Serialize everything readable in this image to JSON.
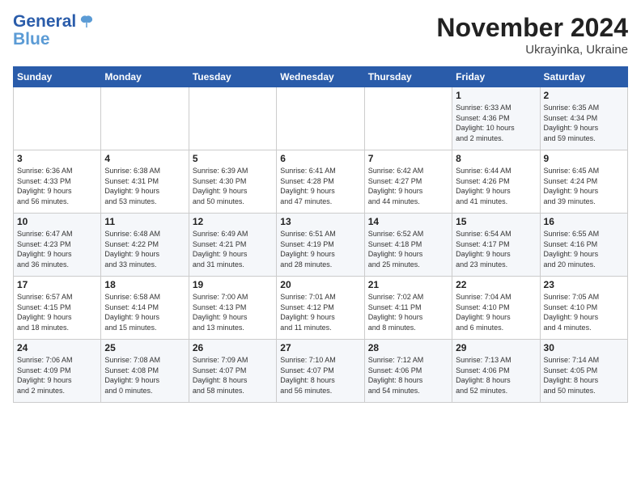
{
  "header": {
    "logo_line1": "General",
    "logo_line2": "Blue",
    "month": "November 2024",
    "location": "Ukrayinka, Ukraine"
  },
  "weekdays": [
    "Sunday",
    "Monday",
    "Tuesday",
    "Wednesday",
    "Thursday",
    "Friday",
    "Saturday"
  ],
  "weeks": [
    [
      {
        "day": "",
        "info": ""
      },
      {
        "day": "",
        "info": ""
      },
      {
        "day": "",
        "info": ""
      },
      {
        "day": "",
        "info": ""
      },
      {
        "day": "",
        "info": ""
      },
      {
        "day": "1",
        "info": "Sunrise: 6:33 AM\nSunset: 4:36 PM\nDaylight: 10 hours\nand 2 minutes."
      },
      {
        "day": "2",
        "info": "Sunrise: 6:35 AM\nSunset: 4:34 PM\nDaylight: 9 hours\nand 59 minutes."
      }
    ],
    [
      {
        "day": "3",
        "info": "Sunrise: 6:36 AM\nSunset: 4:33 PM\nDaylight: 9 hours\nand 56 minutes."
      },
      {
        "day": "4",
        "info": "Sunrise: 6:38 AM\nSunset: 4:31 PM\nDaylight: 9 hours\nand 53 minutes."
      },
      {
        "day": "5",
        "info": "Sunrise: 6:39 AM\nSunset: 4:30 PM\nDaylight: 9 hours\nand 50 minutes."
      },
      {
        "day": "6",
        "info": "Sunrise: 6:41 AM\nSunset: 4:28 PM\nDaylight: 9 hours\nand 47 minutes."
      },
      {
        "day": "7",
        "info": "Sunrise: 6:42 AM\nSunset: 4:27 PM\nDaylight: 9 hours\nand 44 minutes."
      },
      {
        "day": "8",
        "info": "Sunrise: 6:44 AM\nSunset: 4:26 PM\nDaylight: 9 hours\nand 41 minutes."
      },
      {
        "day": "9",
        "info": "Sunrise: 6:45 AM\nSunset: 4:24 PM\nDaylight: 9 hours\nand 39 minutes."
      }
    ],
    [
      {
        "day": "10",
        "info": "Sunrise: 6:47 AM\nSunset: 4:23 PM\nDaylight: 9 hours\nand 36 minutes."
      },
      {
        "day": "11",
        "info": "Sunrise: 6:48 AM\nSunset: 4:22 PM\nDaylight: 9 hours\nand 33 minutes."
      },
      {
        "day": "12",
        "info": "Sunrise: 6:49 AM\nSunset: 4:21 PM\nDaylight: 9 hours\nand 31 minutes."
      },
      {
        "day": "13",
        "info": "Sunrise: 6:51 AM\nSunset: 4:19 PM\nDaylight: 9 hours\nand 28 minutes."
      },
      {
        "day": "14",
        "info": "Sunrise: 6:52 AM\nSunset: 4:18 PM\nDaylight: 9 hours\nand 25 minutes."
      },
      {
        "day": "15",
        "info": "Sunrise: 6:54 AM\nSunset: 4:17 PM\nDaylight: 9 hours\nand 23 minutes."
      },
      {
        "day": "16",
        "info": "Sunrise: 6:55 AM\nSunset: 4:16 PM\nDaylight: 9 hours\nand 20 minutes."
      }
    ],
    [
      {
        "day": "17",
        "info": "Sunrise: 6:57 AM\nSunset: 4:15 PM\nDaylight: 9 hours\nand 18 minutes."
      },
      {
        "day": "18",
        "info": "Sunrise: 6:58 AM\nSunset: 4:14 PM\nDaylight: 9 hours\nand 15 minutes."
      },
      {
        "day": "19",
        "info": "Sunrise: 7:00 AM\nSunset: 4:13 PM\nDaylight: 9 hours\nand 13 minutes."
      },
      {
        "day": "20",
        "info": "Sunrise: 7:01 AM\nSunset: 4:12 PM\nDaylight: 9 hours\nand 11 minutes."
      },
      {
        "day": "21",
        "info": "Sunrise: 7:02 AM\nSunset: 4:11 PM\nDaylight: 9 hours\nand 8 minutes."
      },
      {
        "day": "22",
        "info": "Sunrise: 7:04 AM\nSunset: 4:10 PM\nDaylight: 9 hours\nand 6 minutes."
      },
      {
        "day": "23",
        "info": "Sunrise: 7:05 AM\nSunset: 4:10 PM\nDaylight: 9 hours\nand 4 minutes."
      }
    ],
    [
      {
        "day": "24",
        "info": "Sunrise: 7:06 AM\nSunset: 4:09 PM\nDaylight: 9 hours\nand 2 minutes."
      },
      {
        "day": "25",
        "info": "Sunrise: 7:08 AM\nSunset: 4:08 PM\nDaylight: 9 hours\nand 0 minutes."
      },
      {
        "day": "26",
        "info": "Sunrise: 7:09 AM\nSunset: 4:07 PM\nDaylight: 8 hours\nand 58 minutes."
      },
      {
        "day": "27",
        "info": "Sunrise: 7:10 AM\nSunset: 4:07 PM\nDaylight: 8 hours\nand 56 minutes."
      },
      {
        "day": "28",
        "info": "Sunrise: 7:12 AM\nSunset: 4:06 PM\nDaylight: 8 hours\nand 54 minutes."
      },
      {
        "day": "29",
        "info": "Sunrise: 7:13 AM\nSunset: 4:06 PM\nDaylight: 8 hours\nand 52 minutes."
      },
      {
        "day": "30",
        "info": "Sunrise: 7:14 AM\nSunset: 4:05 PM\nDaylight: 8 hours\nand 50 minutes."
      }
    ]
  ]
}
